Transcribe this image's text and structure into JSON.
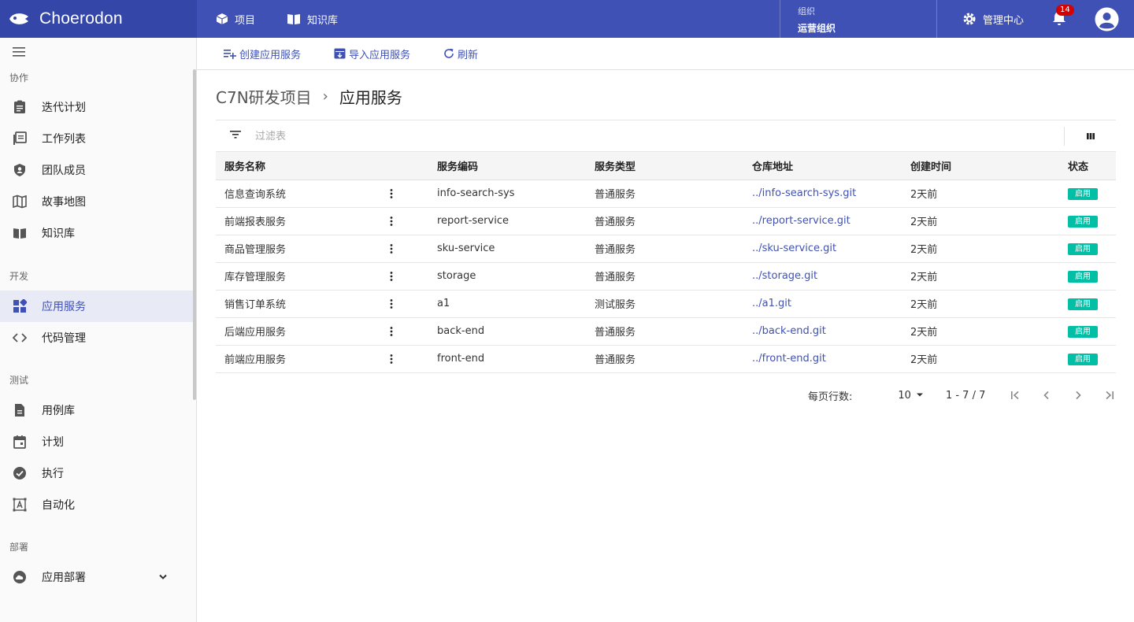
{
  "header": {
    "brand": "Choerodon",
    "nav": [
      {
        "label": "项目",
        "icon": "cube-icon"
      },
      {
        "label": "知识库",
        "icon": "book-icon"
      }
    ],
    "org_label": "组织",
    "org_value": "运营组织",
    "admin_label": "管理中心",
    "notification_count": "14"
  },
  "sidebar": {
    "groups": [
      {
        "label": "协作"
      },
      {
        "label": "开发"
      },
      {
        "label": "测试"
      },
      {
        "label": "部署"
      }
    ],
    "items": [
      {
        "label": "迭代计划",
        "icon": "clipboard-icon"
      },
      {
        "label": "工作列表",
        "icon": "list-icon"
      },
      {
        "label": "团队成员",
        "icon": "shield-user-icon"
      },
      {
        "label": "故事地图",
        "icon": "map-icon"
      },
      {
        "label": "知识库",
        "icon": "book-icon"
      },
      {
        "label": "应用服务",
        "icon": "dashboard-icon",
        "active": true
      },
      {
        "label": "代码管理",
        "icon": "code-icon"
      },
      {
        "label": "用例库",
        "icon": "document-icon"
      },
      {
        "label": "计划",
        "icon": "calendar-icon"
      },
      {
        "label": "执行",
        "icon": "check-circle-icon"
      },
      {
        "label": "自动化",
        "icon": "automation-icon"
      },
      {
        "label": "应用部署",
        "icon": "cloud-icon"
      }
    ]
  },
  "toolbar": {
    "create_label": "创建应用服务",
    "import_label": "导入应用服务",
    "refresh_label": "刷新"
  },
  "breadcrumb": {
    "parent": "C7N研发项目",
    "current": "应用服务"
  },
  "filter": {
    "placeholder": "过滤表"
  },
  "table": {
    "columns": [
      "服务名称",
      "服务编码",
      "服务类型",
      "仓库地址",
      "创建时间",
      "状态"
    ],
    "rows": [
      {
        "name": "信息查询系统",
        "code": "info-search-sys",
        "type": "普通服务",
        "repo": "../info-search-sys.git",
        "created": "2天前",
        "status": "启用"
      },
      {
        "name": "前端报表服务",
        "code": "report-service",
        "type": "普通服务",
        "repo": "../report-service.git",
        "created": "2天前",
        "status": "启用"
      },
      {
        "name": "商品管理服务",
        "code": "sku-service",
        "type": "普通服务",
        "repo": "../sku-service.git",
        "created": "2天前",
        "status": "启用"
      },
      {
        "name": "库存管理服务",
        "code": "storage",
        "type": "普通服务",
        "repo": "../storage.git",
        "created": "2天前",
        "status": "启用"
      },
      {
        "name": "销售订单系统",
        "code": "a1",
        "type": "测试服务",
        "repo": "../a1.git",
        "created": "2天前",
        "status": "启用"
      },
      {
        "name": "后端应用服务",
        "code": "back-end",
        "type": "普通服务",
        "repo": "../back-end.git",
        "created": "2天前",
        "status": "启用"
      },
      {
        "name": "前端应用服务",
        "code": "front-end",
        "type": "普通服务",
        "repo": "../front-end.git",
        "created": "2天前",
        "status": "启用"
      }
    ]
  },
  "pagination": {
    "rows_per_page_label": "每页行数:",
    "page_size": "10",
    "range": "1 - 7 / 7"
  },
  "colors": {
    "primary": "#3f51b5",
    "status_enabled": "#00bfa5"
  }
}
